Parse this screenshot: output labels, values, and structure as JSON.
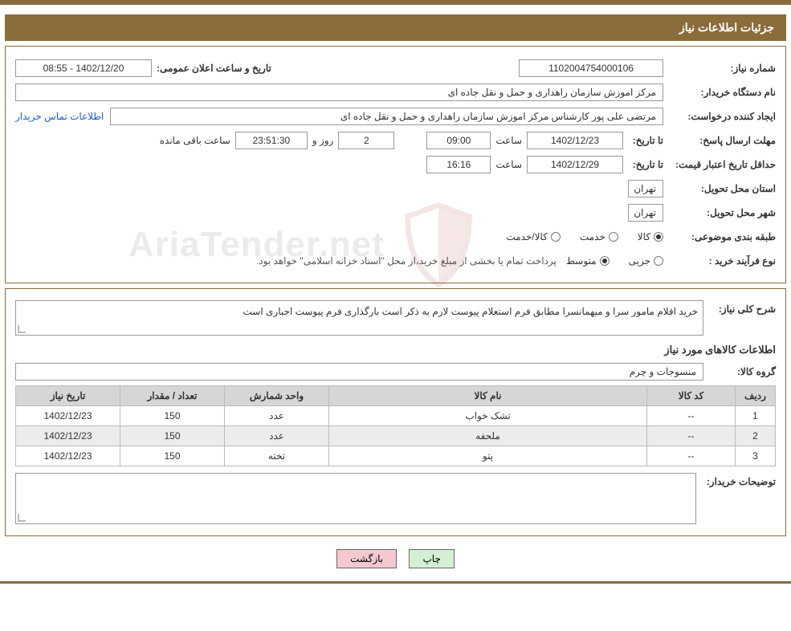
{
  "header": {
    "title": "جزئیات اطلاعات نیاز"
  },
  "info": {
    "need_no_label": "شماره نیاز:",
    "need_no": "1102004754000106",
    "announce_label": "تاریخ و ساعت اعلان عمومی:",
    "announce_value": "1402/12/20 - 08:55",
    "buyer_org_label": "نام دستگاه خریدار:",
    "buyer_org": "مرکز اموزش سازمان راهداری و حمل و نقل جاده ای",
    "requester_label": "ایجاد کننده درخواست:",
    "requester": "مرتضی علی پور کارشناس مرکز اموزش سازمان راهداری و حمل و نقل جاده ای",
    "contact_link": "اطلاعات تماس خریدار",
    "reply_deadline_label": "مهلت ارسال پاسخ:",
    "until": "تا تاریخ:",
    "reply_date": "1402/12/23",
    "time_label": "ساعت",
    "reply_time": "09:00",
    "days_val": "2",
    "days_and": "روز و",
    "countdown": "23:51:30",
    "remaining": "ساعت باقی مانده",
    "min_valid_label": "حداقل تاریخ اعتبار قیمت:",
    "valid_date": "1402/12/29",
    "valid_time": "16:16",
    "province_label": "استان محل تحویل:",
    "province": "تهران",
    "city_label": "شهر محل تحویل:",
    "city": "تهران",
    "category_label": "طبقه بندی موضوعی:",
    "cat_goods": "کالا",
    "cat_service": "خدمت",
    "cat_goods_service": "کالا/خدمت",
    "purchase_type_label": "نوع فرآیند خرید :",
    "pt_minor": "جزیی",
    "pt_medium": "متوسط",
    "pt_note": "پرداخت تمام یا بخشی از مبلغ خرید،از محل \"اسناد خزانه اسلامی\" خواهد بود."
  },
  "need": {
    "desc_label": "شرح کلی نیاز:",
    "desc": "خرید اقلام مامور سرا و میهمانسرا مطابق فرم استعلام پیوست لازم به ذکر است بارگذاری فرم پیوست اجباری است",
    "items_title": "اطلاعات کالاهای مورد نیاز",
    "group_label": "گروه کالا:",
    "group": "منسوجات و چرم",
    "th_row": "ردیف",
    "th_code": "کد کالا",
    "th_name": "نام کالا",
    "th_unit": "واحد شمارش",
    "th_qty": "تعداد / مقدار",
    "th_date": "تاریخ نیاز",
    "rows": [
      {
        "n": "1",
        "code": "--",
        "name": "تشک خواب",
        "unit": "عدد",
        "qty": "150",
        "date": "1402/12/23"
      },
      {
        "n": "2",
        "code": "--",
        "name": "ملحفه",
        "unit": "عدد",
        "qty": "150",
        "date": "1402/12/23"
      },
      {
        "n": "3",
        "code": "--",
        "name": "پتو",
        "unit": "تخته",
        "qty": "150",
        "date": "1402/12/23"
      }
    ],
    "buyer_notes_label": "توضیحات خریدار:",
    "buyer_notes": ""
  },
  "buttons": {
    "print": "چاپ",
    "back": "بازگشت"
  },
  "watermark": {
    "text": "AriaTender.net"
  }
}
